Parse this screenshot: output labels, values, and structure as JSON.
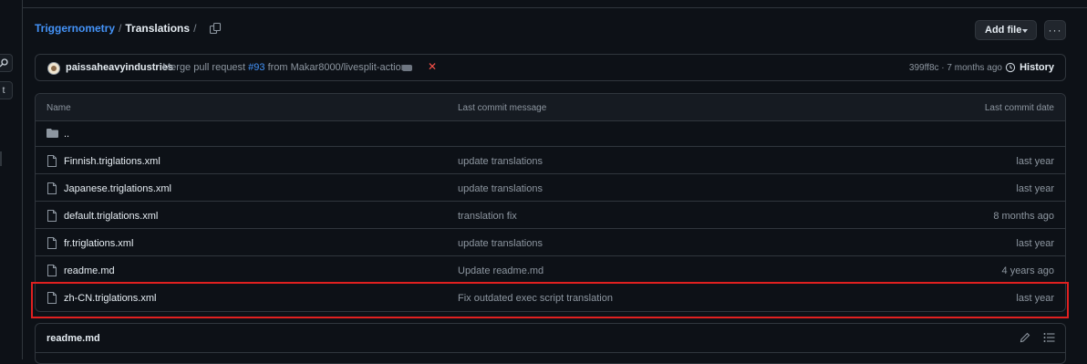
{
  "breadcrumb": {
    "repo": "Triggernometry",
    "sep1": "/",
    "folder": "Translations",
    "sep2": "/"
  },
  "actions": {
    "add_file": "Add file",
    "more": "···"
  },
  "commit": {
    "author": "paissaheavyindustries",
    "message_prefix": "Merge pull request ",
    "pr_number": "#93",
    "message_suffix": " from Makar8000/livesplit-action",
    "status": "✕",
    "sha_time": "399ff8c · 7 months ago",
    "history_label": "History"
  },
  "table": {
    "headers": {
      "name": "Name",
      "message": "Last commit message",
      "date": "Last commit date"
    },
    "parent_dir": "..",
    "rows": [
      {
        "name": "Finnish.triglations.xml",
        "message": "update translations",
        "date": "last year"
      },
      {
        "name": "Japanese.triglations.xml",
        "message": "update translations",
        "date": "last year"
      },
      {
        "name": "default.triglations.xml",
        "message": "translation fix",
        "date": "8 months ago"
      },
      {
        "name": "fr.triglations.xml",
        "message": "update translations",
        "date": "last year"
      },
      {
        "name": "readme.md",
        "message": "Update readme.md",
        "date": "4 years ago"
      },
      {
        "name": "zh-CN.triglations.xml",
        "message": "Fix outdated exec script translation",
        "date": "last year"
      }
    ]
  },
  "readme": {
    "title": "readme.md"
  },
  "sidebar": {
    "button_label": "t"
  },
  "colors": {
    "link": "#4493f8",
    "highlight": "#e02020",
    "background": "#0d1117",
    "border": "#30363d"
  }
}
